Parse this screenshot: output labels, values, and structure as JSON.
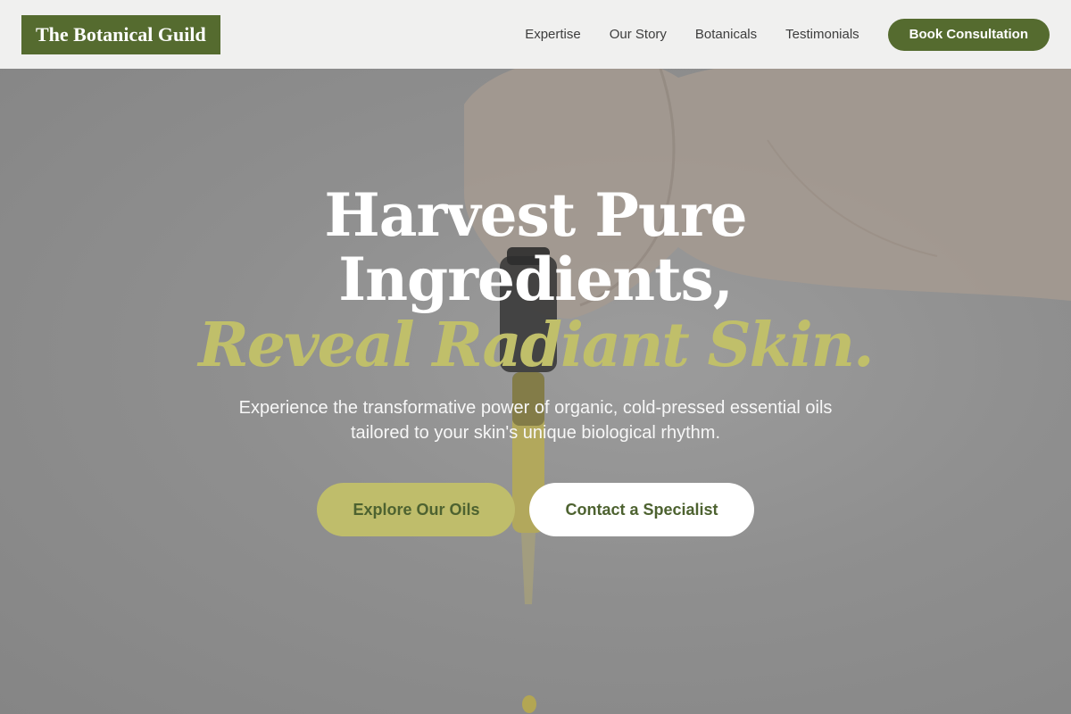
{
  "nav": {
    "logo": "The Botanical Guild",
    "links": [
      "Expertise",
      "Our Story",
      "Botanicals",
      "Testimonials"
    ],
    "cta": "Book Consultation"
  },
  "hero": {
    "headline_line1": "Harvest Pure Ingredients,",
    "headline_line2": "Reveal Radiant Skin.",
    "subtitle": "Experience the transformative power of organic, cold-pressed essential oils tailored to your skin's unique biological rhythm.",
    "primary_button": "Explore Our Oils",
    "secondary_button": "Contact a Specialist"
  },
  "colors": {
    "brand_green": "#556b2f",
    "accent_olive": "#c0bf6a",
    "nav_bg": "#f4f4f3"
  }
}
